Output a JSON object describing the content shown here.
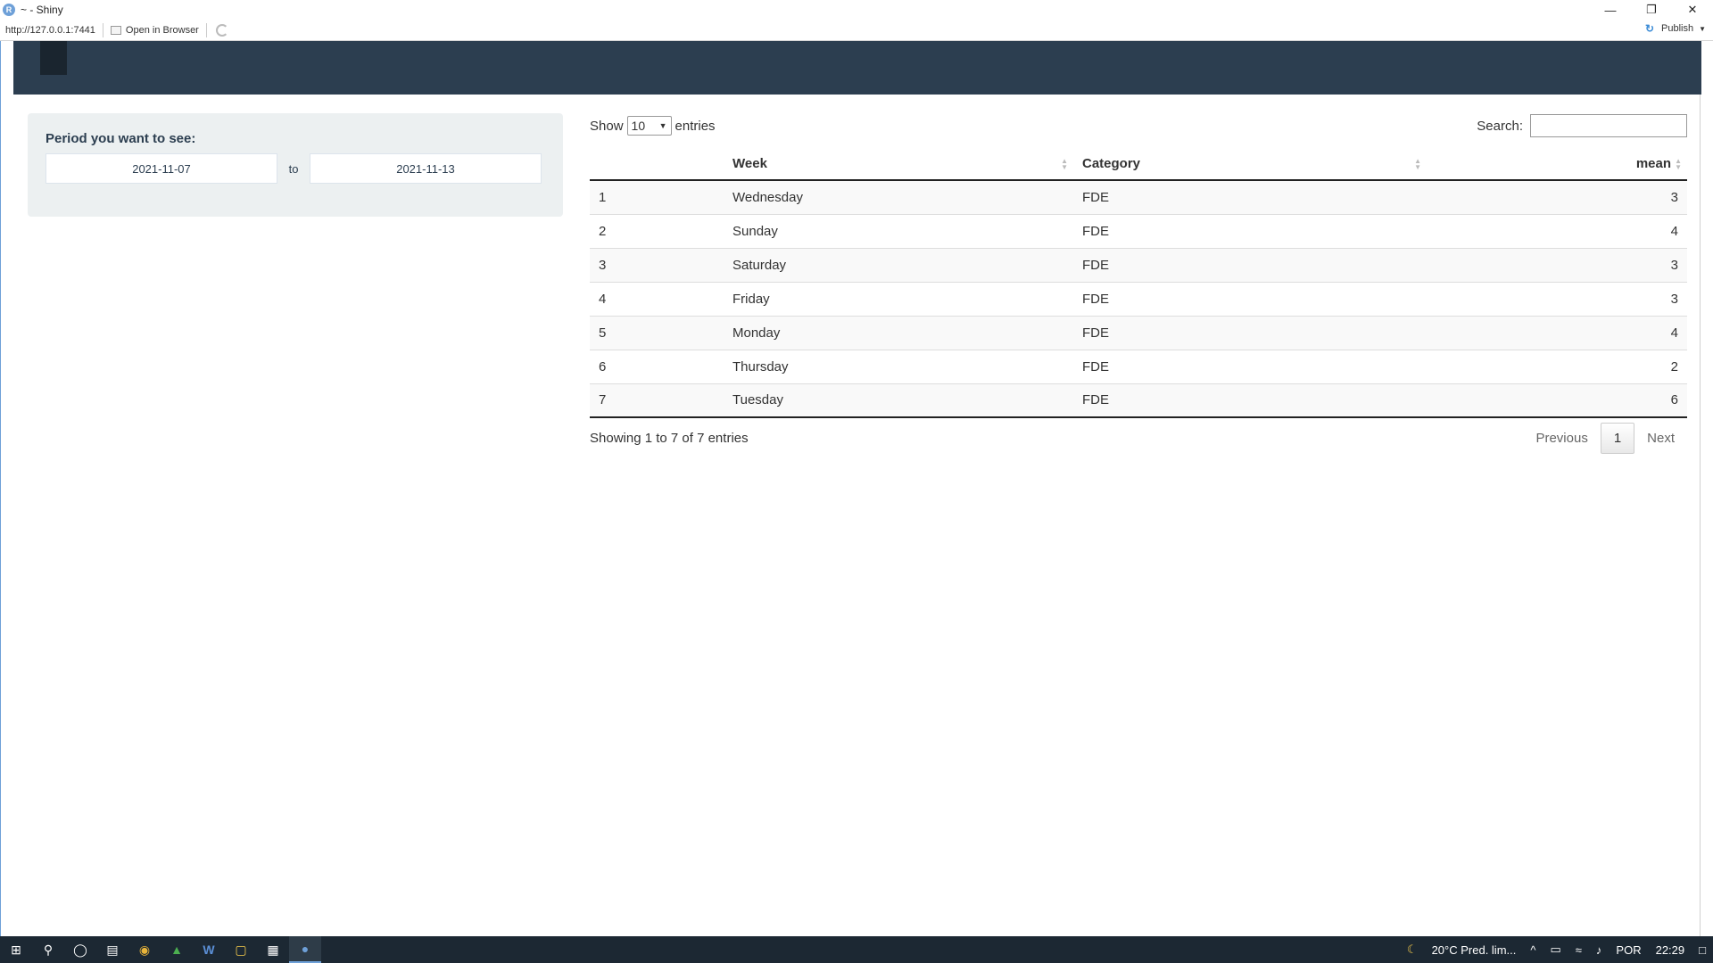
{
  "window": {
    "title": "~ - Shiny",
    "url": "http://127.0.0.1:7441",
    "open_in_browser": "Open in Browser",
    "publish": "Publish"
  },
  "sidebar": {
    "period_label": "Period you want to see:",
    "start_date": "2021-11-07",
    "separator": "to",
    "end_date": "2021-11-13"
  },
  "datatable": {
    "show_label": "Show",
    "page_length": "10",
    "entries_label": "entries",
    "search_label": "Search:",
    "columns": [
      "",
      "Week",
      "Category",
      "mean"
    ],
    "rows": [
      {
        "idx": "1",
        "week": "Wednesday",
        "category": "FDE",
        "mean": "3"
      },
      {
        "idx": "2",
        "week": "Sunday",
        "category": "FDE",
        "mean": "4"
      },
      {
        "idx": "3",
        "week": "Saturday",
        "category": "FDE",
        "mean": "3"
      },
      {
        "idx": "4",
        "week": "Friday",
        "category": "FDE",
        "mean": "3"
      },
      {
        "idx": "5",
        "week": "Monday",
        "category": "FDE",
        "mean": "4"
      },
      {
        "idx": "6",
        "week": "Thursday",
        "category": "FDE",
        "mean": "2"
      },
      {
        "idx": "7",
        "week": "Tuesday",
        "category": "FDE",
        "mean": "6"
      }
    ],
    "info": "Showing 1 to 7 of 7 entries",
    "previous": "Previous",
    "current_page": "1",
    "next": "Next"
  },
  "taskbar": {
    "weather": "20°C  Pred. lim...",
    "language": "POR",
    "time": "22:29"
  },
  "colors": {
    "navbar": "#2c3e50",
    "well": "#ecf0f1",
    "taskbar": "#1c2833"
  }
}
